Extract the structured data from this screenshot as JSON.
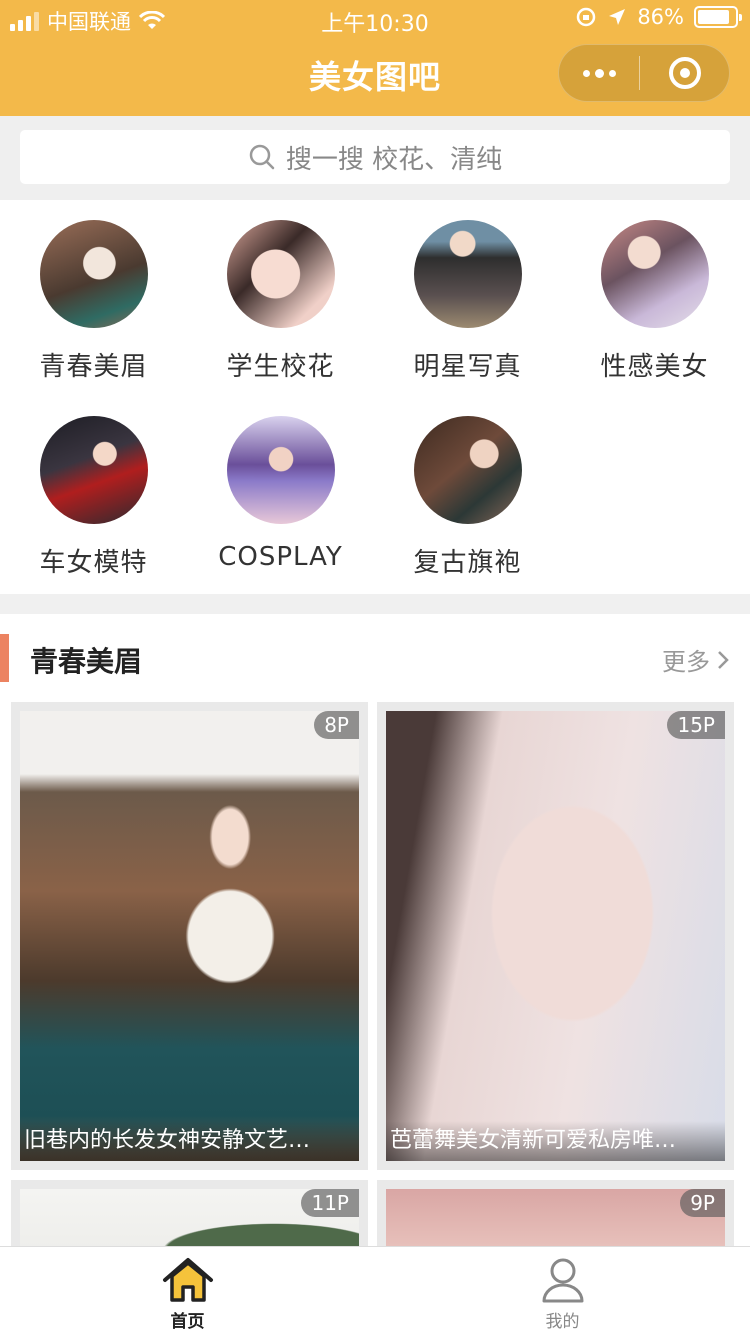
{
  "status_bar": {
    "carrier": "中国联通",
    "time": "上午10:30",
    "battery": "86%",
    "battery_level": 0.86
  },
  "nav": {
    "title": "美女图吧"
  },
  "search": {
    "placeholder": "搜一搜 校花、清纯"
  },
  "categories": [
    {
      "label": "青春美眉"
    },
    {
      "label": "学生校花"
    },
    {
      "label": "明星写真"
    },
    {
      "label": "性感美女"
    },
    {
      "label": "车女模特"
    },
    {
      "label": "COSPLAY"
    },
    {
      "label": "复古旗袍"
    }
  ],
  "section": {
    "title": "青春美眉",
    "more": "更多"
  },
  "cards": [
    {
      "count": "8P",
      "caption": "旧巷内的长发女神安静文艺…"
    },
    {
      "count": "15P",
      "caption": "芭蕾舞美女清新可爱私房唯…"
    },
    {
      "count": "11P",
      "caption": ""
    },
    {
      "count": "9P",
      "caption": ""
    }
  ],
  "tabbar": {
    "home": "首页",
    "mine": "我的"
  },
  "colors": {
    "brand": "#f3b94a",
    "accent_bar": "#ec8361",
    "tab_active": "#222222",
    "tab_inactive": "#888888"
  }
}
